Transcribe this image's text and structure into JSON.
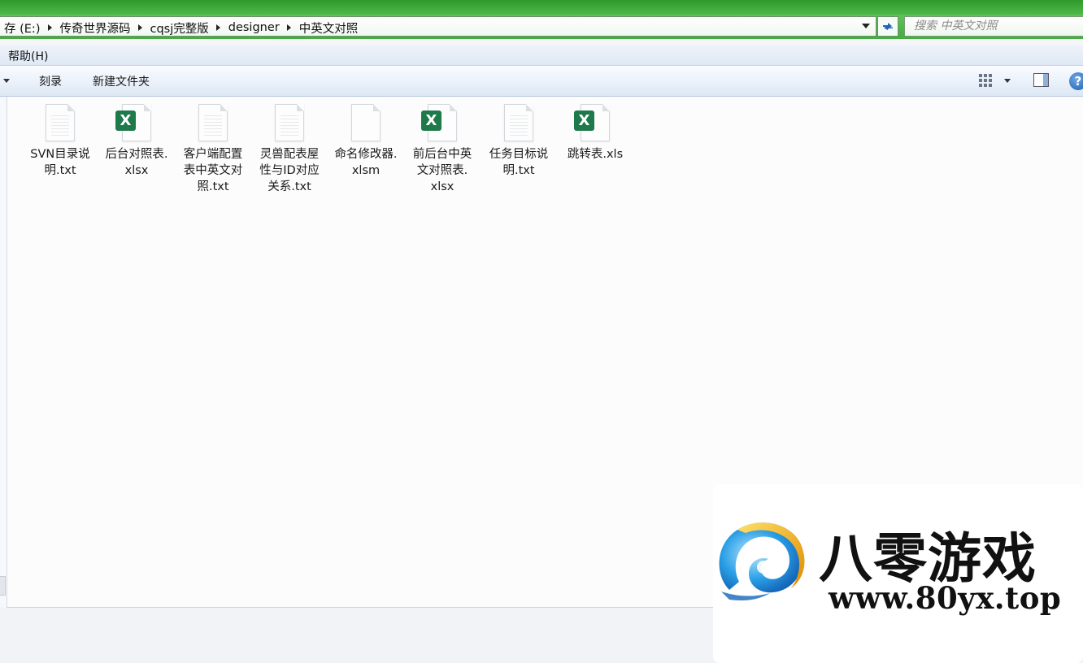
{
  "address": {
    "crumbs": [
      "存 (E:)",
      "传奇世界源码",
      "cqsj完整版",
      "designer",
      "中英文对照"
    ],
    "search_placeholder": "搜索 中英文对照"
  },
  "menu": {
    "help": "帮助(H)"
  },
  "toolbar": {
    "burn": "刻录",
    "new_folder": "新建文件夹"
  },
  "files": [
    {
      "lines": [
        "SVN目录说",
        "明.txt"
      ],
      "type": "txt"
    },
    {
      "lines": [
        "后台对照表.",
        "xlsx"
      ],
      "type": "excel"
    },
    {
      "lines": [
        "客户端配置",
        "表中英文对",
        "照.txt"
      ],
      "type": "txt"
    },
    {
      "lines": [
        "灵兽配表屋",
        "性与ID对应",
        "关系.txt"
      ],
      "type": "txt"
    },
    {
      "lines": [
        "命名修改器.",
        "xlsm"
      ],
      "type": "blank"
    },
    {
      "lines": [
        "前后台中英",
        "文对照表.",
        "xlsx"
      ],
      "type": "excel"
    },
    {
      "lines": [
        "任务目标说",
        "明.txt"
      ],
      "type": "txt"
    },
    {
      "lines": [
        "跳转表.xls"
      ],
      "type": "excel"
    }
  ],
  "watermark": {
    "title": "八零游戏",
    "url": "www.80yx.top"
  },
  "icons": {
    "excel_letter": "X",
    "help_glyph": "?"
  },
  "colors": {
    "title_green": "#3aa835",
    "excel_green": "#1f7a4b",
    "help_blue": "#1f5fae"
  }
}
